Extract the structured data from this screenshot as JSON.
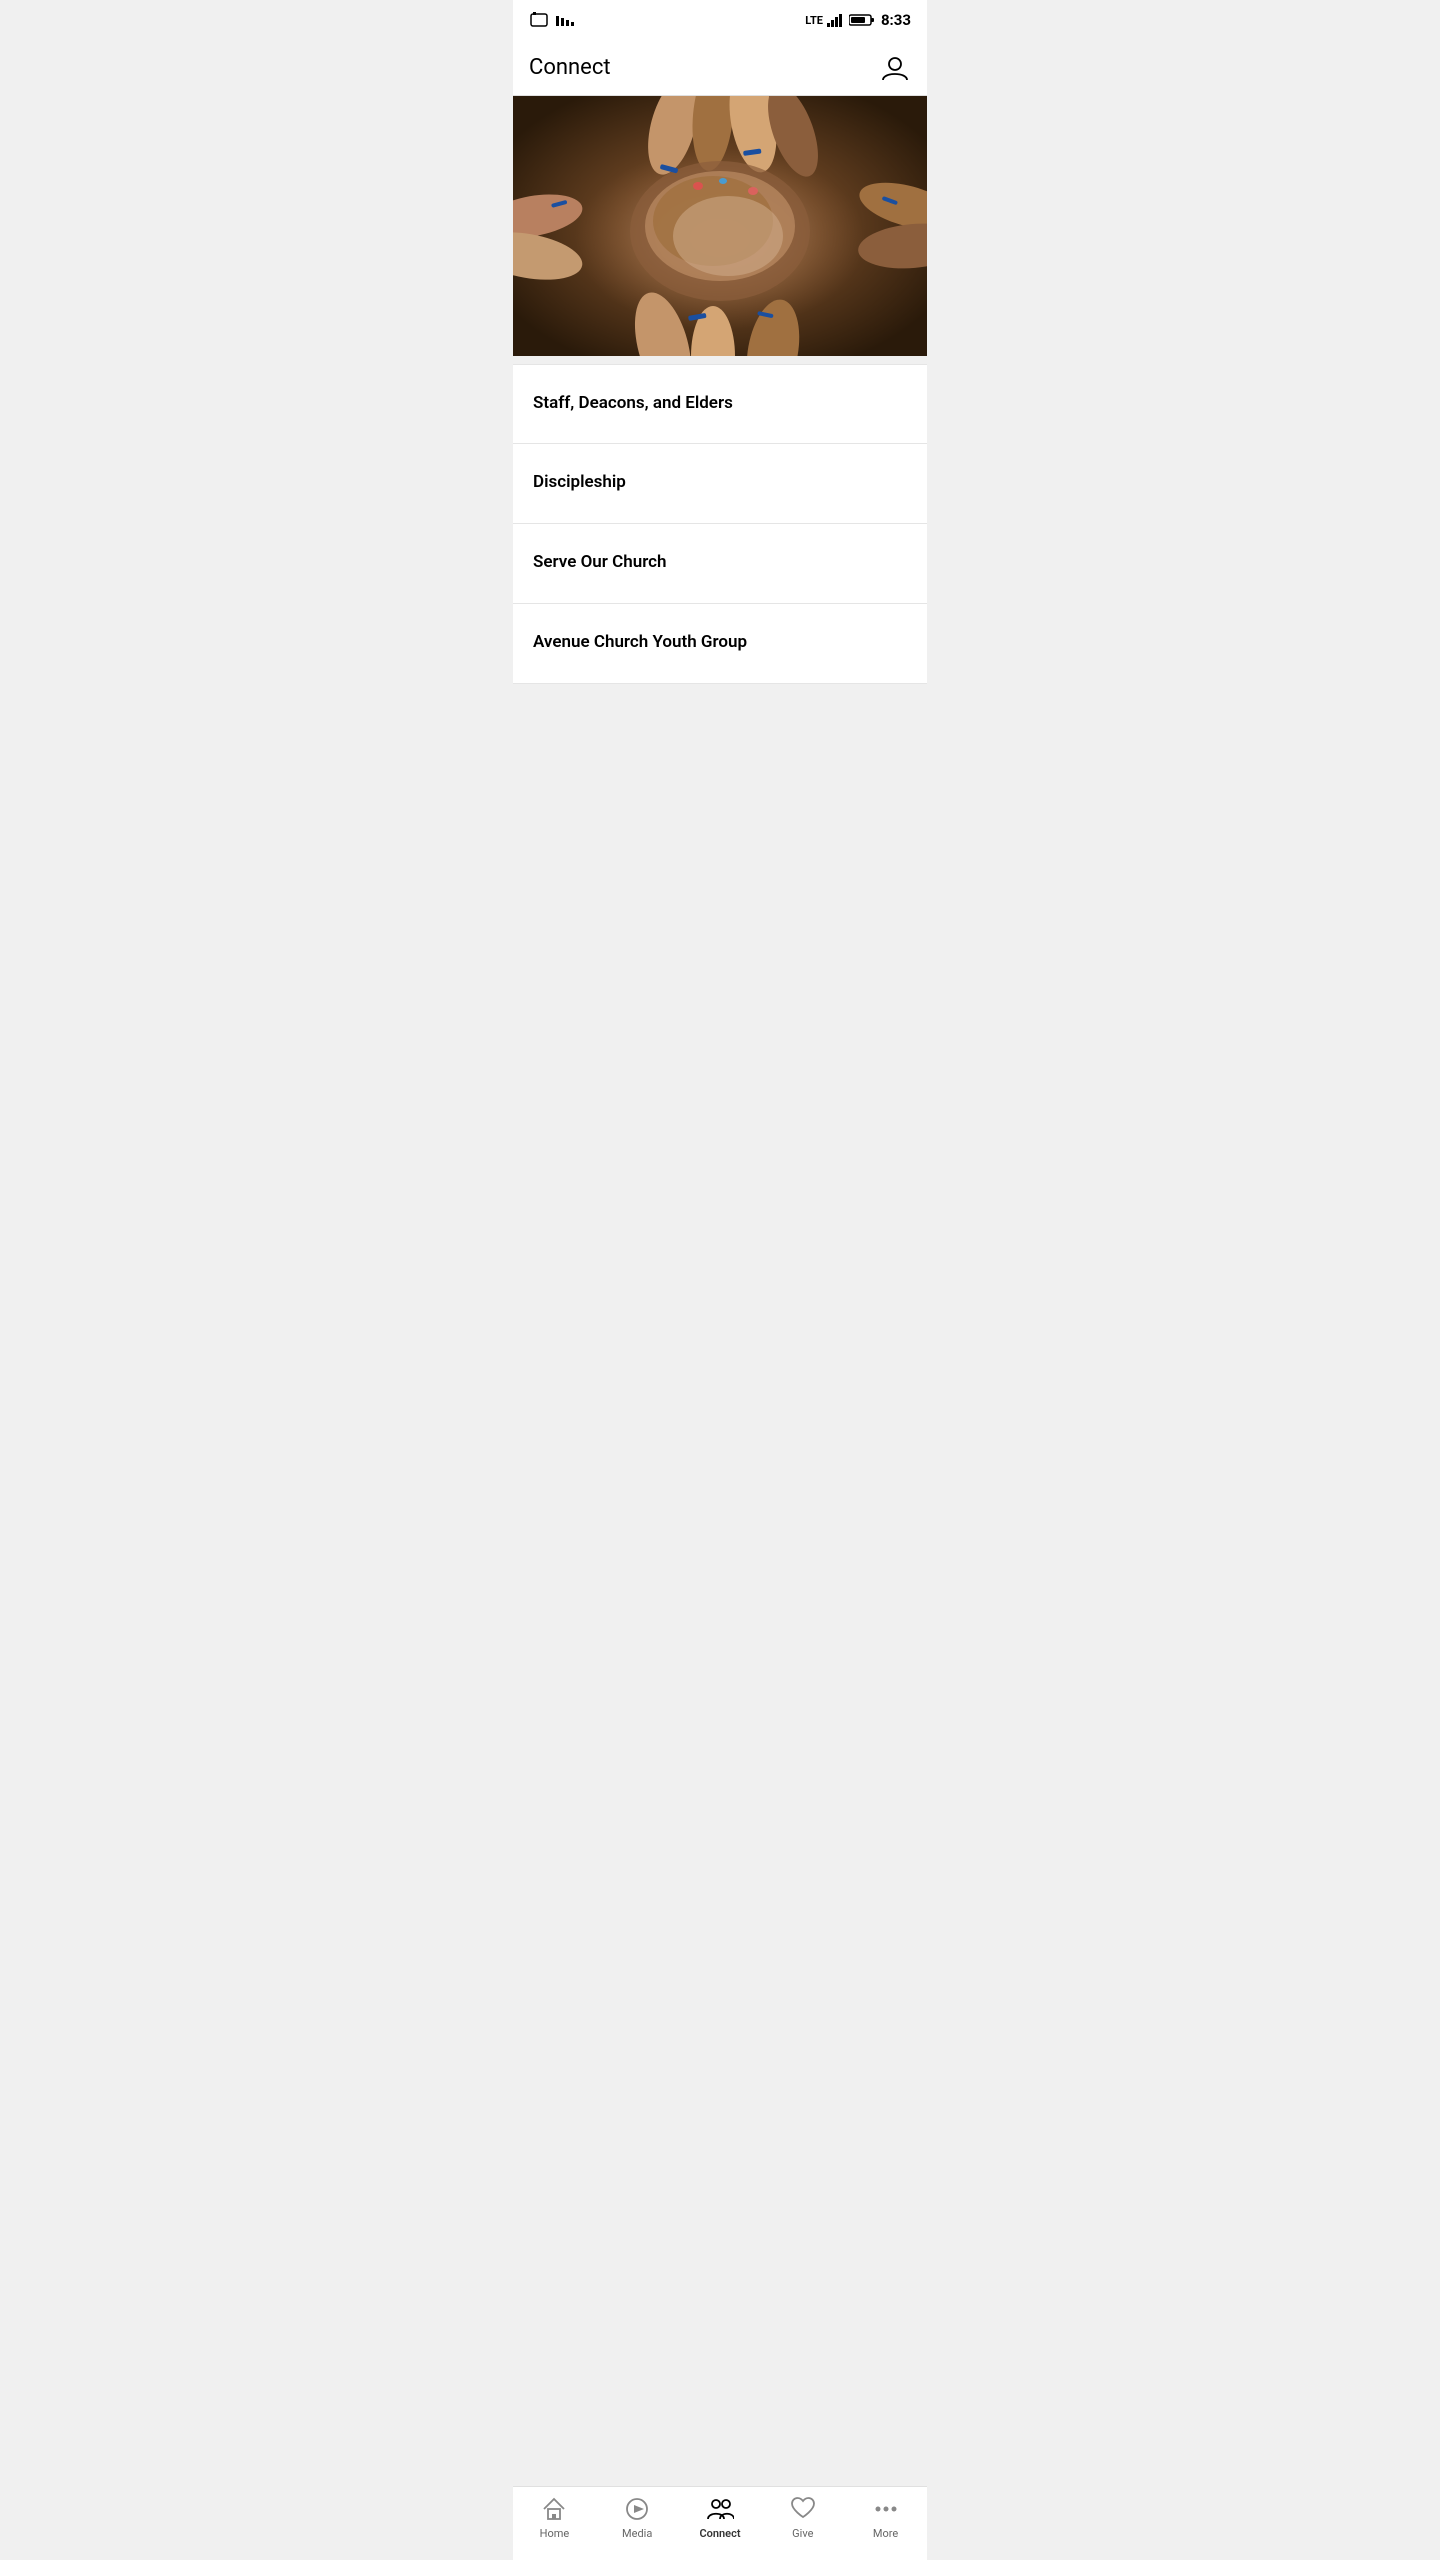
{
  "statusBar": {
    "time": "8:33",
    "lteLabel": "LTE",
    "batteryIcon": "🔋",
    "simIcon": "📶"
  },
  "navBar": {
    "title": "Connect",
    "profileIconLabel": "profile-icon"
  },
  "heroImage": {
    "altText": "Hands joined together community photo"
  },
  "listItems": [
    {
      "id": 1,
      "label": "Staff, Deacons, and Elders"
    },
    {
      "id": 2,
      "label": "Discipleship"
    },
    {
      "id": 3,
      "label": "Serve Our Church"
    },
    {
      "id": 4,
      "label": "Avenue Church Youth Group"
    }
  ],
  "bottomNav": {
    "items": [
      {
        "id": "home",
        "label": "Home",
        "icon": "home"
      },
      {
        "id": "media",
        "label": "Media",
        "icon": "play"
      },
      {
        "id": "connect",
        "label": "Connect",
        "icon": "connect",
        "active": true
      },
      {
        "id": "give",
        "label": "Give",
        "icon": "heart"
      },
      {
        "id": "more",
        "label": "More",
        "icon": "dots"
      }
    ]
  },
  "systemNav": {
    "backLabel": "◁",
    "homeLabel": "○",
    "recentLabel": "□"
  }
}
